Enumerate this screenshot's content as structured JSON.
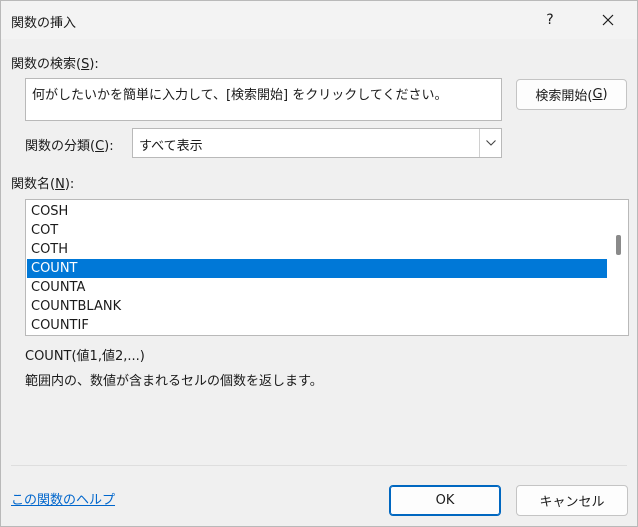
{
  "window": {
    "title": "関数の挿入",
    "help_label": "?"
  },
  "search": {
    "label_prefix": "関数の検索(",
    "label_key": "S",
    "label_suffix": "):",
    "text": "何がしたいかを簡単に入力して、[検索開始] をクリックしてください。",
    "button_prefix": "検索開始(",
    "button_key": "G",
    "button_suffix": ")"
  },
  "category": {
    "label_prefix": "関数の分類(",
    "label_key": "C",
    "label_suffix": "):",
    "value": "すべて表示"
  },
  "functions": {
    "label_prefix": "関数名(",
    "label_key": "N",
    "label_suffix": "):",
    "items": [
      "COSH",
      "COT",
      "COTH",
      "COUNT",
      "COUNTA",
      "COUNTBLANK",
      "COUNTIF"
    ],
    "selected_index": 3
  },
  "description": {
    "syntax": "COUNT(値1,値2,...)",
    "text": "範囲内の、数値が含まれるセルの個数を返します。"
  },
  "footer": {
    "help_link": "この関数のヘルプ",
    "ok_label": "OK",
    "cancel_label": "キャンセル"
  },
  "colors": {
    "selection": "#0078d7",
    "link": "#0066cc",
    "ok_border": "#0067c0"
  }
}
